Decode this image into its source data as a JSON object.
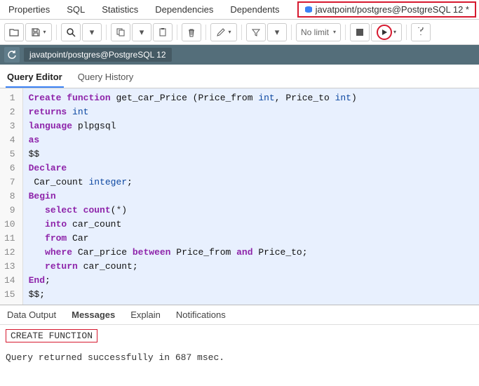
{
  "topTabs": {
    "properties": "Properties",
    "sql": "SQL",
    "statistics": "Statistics",
    "dependencies": "Dependencies",
    "dependents": "Dependents"
  },
  "connTab": "javatpoint/postgres@PostgreSQL 12 *",
  "limitLabel": "No limit",
  "connBar": "javatpoint/postgres@PostgreSQL 12",
  "editorTabs": {
    "query": "Query Editor",
    "history": "Query History"
  },
  "code": [
    {
      "n": 1,
      "tokens": [
        [
          "kw",
          "Create"
        ],
        [
          "sp",
          " "
        ],
        [
          "kw",
          "function"
        ],
        [
          "sp",
          " "
        ],
        [
          "fn",
          "get_car_Price ("
        ],
        [
          "fn",
          "Price_from "
        ],
        [
          "ty",
          "int"
        ],
        [
          "fn",
          ", Price_to "
        ],
        [
          "ty",
          "int"
        ],
        [
          "fn",
          ")"
        ]
      ]
    },
    {
      "n": 2,
      "tokens": [
        [
          "kw",
          "returns"
        ],
        [
          "sp",
          " "
        ],
        [
          "ty",
          "int"
        ]
      ]
    },
    {
      "n": 3,
      "tokens": [
        [
          "kw",
          "language"
        ],
        [
          "sp",
          " "
        ],
        [
          "fn",
          "plpgsql"
        ]
      ]
    },
    {
      "n": 4,
      "tokens": [
        [
          "kw",
          "as"
        ]
      ]
    },
    {
      "n": 5,
      "tokens": [
        [
          "dd",
          "$$"
        ]
      ]
    },
    {
      "n": 6,
      "tokens": [
        [
          "kw",
          "Declare"
        ]
      ]
    },
    {
      "n": 7,
      "tokens": [
        [
          "sp",
          " "
        ],
        [
          "fn",
          "Car_count "
        ],
        [
          "ty",
          "integer"
        ],
        [
          "fn",
          ";"
        ]
      ]
    },
    {
      "n": 8,
      "tokens": [
        [
          "kw",
          "Begin"
        ]
      ]
    },
    {
      "n": 9,
      "tokens": [
        [
          "sp",
          "   "
        ],
        [
          "kw",
          "select"
        ],
        [
          "sp",
          " "
        ],
        [
          "kw",
          "count"
        ],
        [
          "fn",
          "("
        ],
        [
          "sp",
          "*"
        ],
        [
          "fn",
          ")"
        ]
      ]
    },
    {
      "n": 10,
      "tokens": [
        [
          "sp",
          "   "
        ],
        [
          "kw",
          "into"
        ],
        [
          "sp",
          " "
        ],
        [
          "fn",
          "car_count"
        ]
      ]
    },
    {
      "n": 11,
      "tokens": [
        [
          "sp",
          "   "
        ],
        [
          "kw",
          "from"
        ],
        [
          "sp",
          " "
        ],
        [
          "fn",
          "Car"
        ]
      ]
    },
    {
      "n": 12,
      "tokens": [
        [
          "sp",
          "   "
        ],
        [
          "kw",
          "where"
        ],
        [
          "sp",
          " "
        ],
        [
          "fn",
          "Car_price "
        ],
        [
          "kw",
          "between"
        ],
        [
          "sp",
          " "
        ],
        [
          "fn",
          "Price_from "
        ],
        [
          "kw",
          "and"
        ],
        [
          "sp",
          " "
        ],
        [
          "fn",
          "Price_to;"
        ]
      ]
    },
    {
      "n": 13,
      "tokens": [
        [
          "sp",
          "   "
        ],
        [
          "kw",
          "return"
        ],
        [
          "sp",
          " "
        ],
        [
          "fn",
          "car_count;"
        ]
      ]
    },
    {
      "n": 14,
      "tokens": [
        [
          "kw",
          "End"
        ],
        [
          "fn",
          ";"
        ]
      ]
    },
    {
      "n": 15,
      "tokens": [
        [
          "dd",
          "$$;"
        ]
      ]
    }
  ],
  "outputTabs": {
    "data": "Data Output",
    "messages": "Messages",
    "explain": "Explain",
    "notifications": "Notifications"
  },
  "messages": {
    "result": "CREATE FUNCTION",
    "status": "Query returned successfully in 687 msec."
  }
}
